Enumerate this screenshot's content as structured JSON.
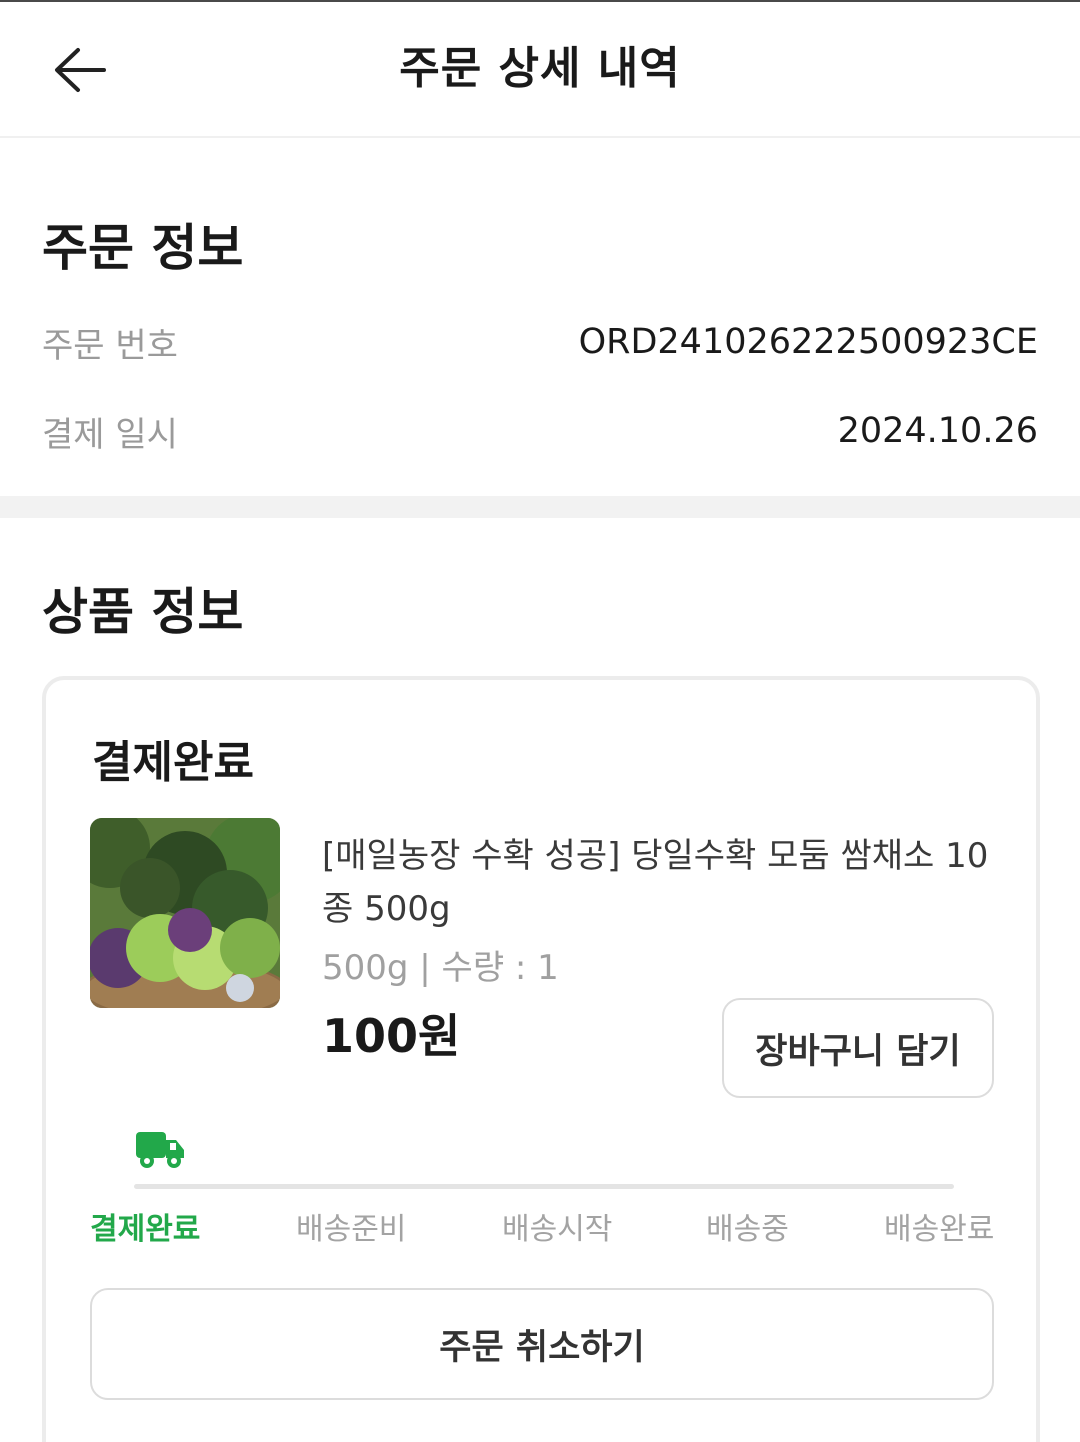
{
  "header": {
    "title": "주문 상세 내역",
    "back_icon": "arrow-left-icon"
  },
  "order_info": {
    "section_title": "주문 정보",
    "rows": [
      {
        "label": "주문 번호",
        "value": "ORD241026222500923CE"
      },
      {
        "label": "결제 일시",
        "value": "2024.10.26"
      }
    ]
  },
  "product_info": {
    "section_title": "상품 정보",
    "card": {
      "status": "결제완료",
      "product_name": "[매일농장 수확 성공] 당일수확 모둠 쌈채소 10종 500g",
      "option": "500g | 수량 : 1",
      "price": "100원",
      "cart_button": "장바구니 담기",
      "cancel_button": "주문 취소하기",
      "truck_icon": "truck-icon",
      "accent_color": "#22a84a",
      "steps": [
        "결제완료",
        "배송준비",
        "배송시작",
        "배송중",
        "배송완료"
      ],
      "active_step": 0
    }
  }
}
